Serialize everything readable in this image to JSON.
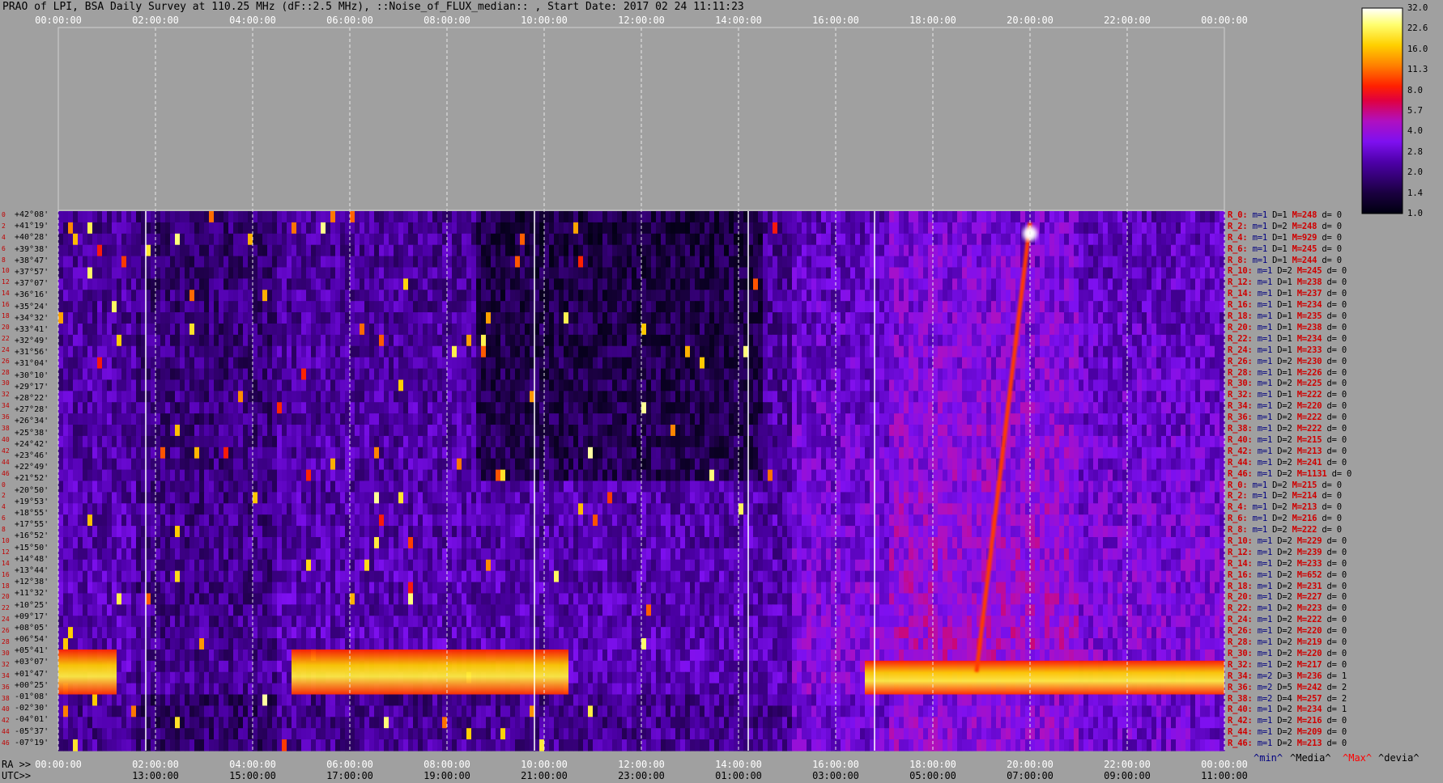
{
  "title": "PRAO of LPI, BSA Daily Survey at 110.25 MHz (dF::2.5 MHz), ::Noise_of_FLUX_median:: , Start Date: 2017 02 24 11:11:23",
  "axes": {
    "top_ticks": [
      "00:00:00",
      "02:00:00",
      "04:00:00",
      "06:00:00",
      "08:00:00",
      "10:00:00",
      "12:00:00",
      "14:00:00",
      "16:00:00",
      "18:00:00",
      "20:00:00",
      "22:00:00",
      "00:00:00"
    ],
    "ra_label": "RA >>",
    "ra_ticks": [
      "00:00:00",
      "02:00:00",
      "04:00:00",
      "06:00:00",
      "08:00:00",
      "10:00:00",
      "12:00:00",
      "14:00:00",
      "16:00:00",
      "18:00:00",
      "20:00:00",
      "22:00:00",
      "00:00:00"
    ],
    "utc_label": "UTC>>",
    "utc_ticks": [
      "13:00:00",
      "15:00:00",
      "17:00:00",
      "19:00:00",
      "21:00:00",
      "23:00:00",
      "01:00:00",
      "03:00:00",
      "05:00:00",
      "07:00:00",
      "09:00:00",
      "11:00:00"
    ]
  },
  "declinations": [
    "+42°08'",
    "+41°19'",
    "+40°28'",
    "+39°38'",
    "+38°47'",
    "+37°57'",
    "+37°07'",
    "+36°16'",
    "+35°24'",
    "+34°32'",
    "+33°41'",
    "+32°49'",
    "+31°56'",
    "+31°04'",
    "+30°10'",
    "+29°17'",
    "+28°22'",
    "+27°28'",
    "+26°34'",
    "+25°38'",
    "+24°42'",
    "+23°46'",
    "+22°49'",
    "+21°52'",
    "+20°50'",
    "+19°53'",
    "+18°55'",
    "+17°55'",
    "+16°52'",
    "+15°50'",
    "+14°48'",
    "+13°44'",
    "+12°38'",
    "+11°32'",
    "+10°25'",
    "+09°17'",
    "+08°05'",
    "+06°54'",
    "+05°41'",
    "+03°07'",
    "+01°47'",
    "+00°25'",
    "-01°08'",
    "-02°30'",
    "-04°01'",
    "-05°37'",
    "-07°19'"
  ],
  "row_indices": [
    "0",
    "2",
    "4",
    "6",
    "8",
    "10",
    "12",
    "14",
    "16",
    "18",
    "20",
    "22",
    "24",
    "26",
    "28",
    "30",
    "32",
    "34",
    "36",
    "38",
    "40",
    "42",
    "44",
    "46"
  ],
  "stats": [
    {
      "r": "R_0:",
      "min": "m=1",
      "med": "D=1",
      "max": "M=248",
      "dev": "d= 0"
    },
    {
      "r": "R_2:",
      "min": "m=1",
      "med": "D=2",
      "max": "M=248",
      "dev": "d= 0"
    },
    {
      "r": "R_4:",
      "min": "m=1",
      "med": "D=1",
      "max": "M=929",
      "dev": "d= 0"
    },
    {
      "r": "R_6:",
      "min": "m=1",
      "med": "D=1",
      "max": "M=245",
      "dev": "d= 0"
    },
    {
      "r": "R_8:",
      "min": "m=1",
      "med": "D=1",
      "max": "M=244",
      "dev": "d= 0"
    },
    {
      "r": "R_10:",
      "min": "m=1",
      "med": "D=2",
      "max": "M=245",
      "dev": "d= 0"
    },
    {
      "r": "R_12:",
      "min": "m=1",
      "med": "D=1",
      "max": "M=238",
      "dev": "d= 0"
    },
    {
      "r": "R_14:",
      "min": "m=1",
      "med": "D=1",
      "max": "M=237",
      "dev": "d= 0"
    },
    {
      "r": "R_16:",
      "min": "m=1",
      "med": "D=1",
      "max": "M=234",
      "dev": "d= 0"
    },
    {
      "r": "R_18:",
      "min": "m=1",
      "med": "D=1",
      "max": "M=235",
      "dev": "d= 0"
    },
    {
      "r": "R_20:",
      "min": "m=1",
      "med": "D=1",
      "max": "M=238",
      "dev": "d= 0"
    },
    {
      "r": "R_22:",
      "min": "m=1",
      "med": "D=1",
      "max": "M=234",
      "dev": "d= 0"
    },
    {
      "r": "R_24:",
      "min": "m=1",
      "med": "D=1",
      "max": "M=233",
      "dev": "d= 0"
    },
    {
      "r": "R_26:",
      "min": "m=1",
      "med": "D=2",
      "max": "M=230",
      "dev": "d= 0"
    },
    {
      "r": "R_28:",
      "min": "m=1",
      "med": "D=1",
      "max": "M=226",
      "dev": "d= 0"
    },
    {
      "r": "R_30:",
      "min": "m=1",
      "med": "D=2",
      "max": "M=225",
      "dev": "d= 0"
    },
    {
      "r": "R_32:",
      "min": "m=1",
      "med": "D=1",
      "max": "M=222",
      "dev": "d= 0"
    },
    {
      "r": "R_34:",
      "min": "m=1",
      "med": "D=2",
      "max": "M=220",
      "dev": "d= 0"
    },
    {
      "r": "R_36:",
      "min": "m=1",
      "med": "D=2",
      "max": "M=222",
      "dev": "d= 0"
    },
    {
      "r": "R_38:",
      "min": "m=1",
      "med": "D=2",
      "max": "M=222",
      "dev": "d= 0"
    },
    {
      "r": "R_40:",
      "min": "m=1",
      "med": "D=2",
      "max": "M=215",
      "dev": "d= 0"
    },
    {
      "r": "R_42:",
      "min": "m=1",
      "med": "D=2",
      "max": "M=213",
      "dev": "d= 0"
    },
    {
      "r": "R_44:",
      "min": "m=1",
      "med": "D=2",
      "max": "M=241",
      "dev": "d= 0"
    },
    {
      "r": "R_46:",
      "min": "m=1",
      "med": "D=2",
      "max": "M=1131",
      "dev": "d= 0"
    },
    {
      "r": "R_0:",
      "min": "m=1",
      "med": "D=2",
      "max": "M=215",
      "dev": "d= 0"
    },
    {
      "r": "R_2:",
      "min": "m=1",
      "med": "D=2",
      "max": "M=214",
      "dev": "d= 0"
    },
    {
      "r": "R_4:",
      "min": "m=1",
      "med": "D=2",
      "max": "M=213",
      "dev": "d= 0"
    },
    {
      "r": "R_6:",
      "min": "m=1",
      "med": "D=2",
      "max": "M=216",
      "dev": "d= 0"
    },
    {
      "r": "R_8:",
      "min": "m=1",
      "med": "D=2",
      "max": "M=222",
      "dev": "d= 0"
    },
    {
      "r": "R_10:",
      "min": "m=1",
      "med": "D=2",
      "max": "M=229",
      "dev": "d= 0"
    },
    {
      "r": "R_12:",
      "min": "m=1",
      "med": "D=2",
      "max": "M=239",
      "dev": "d= 0"
    },
    {
      "r": "R_14:",
      "min": "m=1",
      "med": "D=2",
      "max": "M=233",
      "dev": "d= 0"
    },
    {
      "r": "R_16:",
      "min": "m=1",
      "med": "D=2",
      "max": "M=652",
      "dev": "d= 0"
    },
    {
      "r": "R_18:",
      "min": "m=1",
      "med": "D=2",
      "max": "M=231",
      "dev": "d= 0"
    },
    {
      "r": "R_20:",
      "min": "m=1",
      "med": "D=2",
      "max": "M=227",
      "dev": "d= 0"
    },
    {
      "r": "R_22:",
      "min": "m=1",
      "med": "D=2",
      "max": "M=223",
      "dev": "d= 0"
    },
    {
      "r": "R_24:",
      "min": "m=1",
      "med": "D=2",
      "max": "M=222",
      "dev": "d= 0"
    },
    {
      "r": "R_26:",
      "min": "m=1",
      "med": "D=2",
      "max": "M=220",
      "dev": "d= 0"
    },
    {
      "r": "R_28:",
      "min": "m=1",
      "med": "D=2",
      "max": "M=219",
      "dev": "d= 0"
    },
    {
      "r": "R_30:",
      "min": "m=1",
      "med": "D=2",
      "max": "M=220",
      "dev": "d= 0"
    },
    {
      "r": "R_32:",
      "min": "m=1",
      "med": "D=2",
      "max": "M=217",
      "dev": "d= 0"
    },
    {
      "r": "R_34:",
      "min": "m=2",
      "med": "D=3",
      "max": "M=236",
      "dev": "d= 1"
    },
    {
      "r": "R_36:",
      "min": "m=2",
      "med": "D=5",
      "max": "M=242",
      "dev": "d= 2"
    },
    {
      "r": "R_38:",
      "min": "m=2",
      "med": "D=4",
      "max": "M=257",
      "dev": "d= 2"
    },
    {
      "r": "R_40:",
      "min": "m=1",
      "med": "D=2",
      "max": "M=234",
      "dev": "d= 1"
    },
    {
      "r": "R_42:",
      "min": "m=1",
      "med": "D=2",
      "max": "M=216",
      "dev": "d= 0"
    },
    {
      "r": "R_44:",
      "min": "m=1",
      "med": "D=2",
      "max": "M=209",
      "dev": "d= 0"
    },
    {
      "r": "R_46:",
      "min": "m=1",
      "med": "D=2",
      "max": "M=213",
      "dev": "d= 0"
    }
  ],
  "legend": {
    "min": "^min^",
    "median": "^Media^",
    "max": "^Max^",
    "dev": "^devia^"
  },
  "colors": {
    "background": "#a0a0a0",
    "min": "#000080",
    "median": "#000000",
    "max": "#ff0000",
    "dev": "#000000"
  },
  "chart_data": {
    "type": "heatmap",
    "title": "PRAO of LPI, BSA Daily Survey at 110.25 MHz (dF::2.5 MHz), ::Noise_of_FLUX_median:: , Start Date: 2017 02 24 11:11:23",
    "xlabel": "RA >> / UTC>>",
    "ylabel": "",
    "x_range_hours": [
      0,
      24
    ],
    "rows": 48,
    "colorbar_ticks": [
      "32.0",
      "22.6",
      "16.0",
      "11.3",
      "8.0",
      "5.7",
      "4.0",
      "2.8",
      "2.0",
      "1.4",
      "1.0"
    ],
    "colorbar_values": [
      32.0,
      22.6,
      16.0,
      11.3,
      8.0,
      5.7,
      4.0,
      2.8,
      2.0,
      1.4,
      1.0
    ],
    "bright_bands": [
      {
        "row_range": [
          39,
          43
        ],
        "ra_hours": [
          0.0,
          1.2
        ]
      },
      {
        "row_range": [
          39,
          43
        ],
        "ra_hours": [
          4.8,
          10.5
        ]
      },
      {
        "row_range": [
          40,
          43
        ],
        "ra_hours": [
          16.6,
          24.0
        ]
      }
    ],
    "diagonal_track": {
      "from": {
        "ra_hours": 18.9,
        "row": 41
      },
      "to": {
        "ra_hours": 20.0,
        "row": 1
      }
    },
    "bright_point": {
      "ra_hours": 20.0,
      "row": 2
    }
  }
}
